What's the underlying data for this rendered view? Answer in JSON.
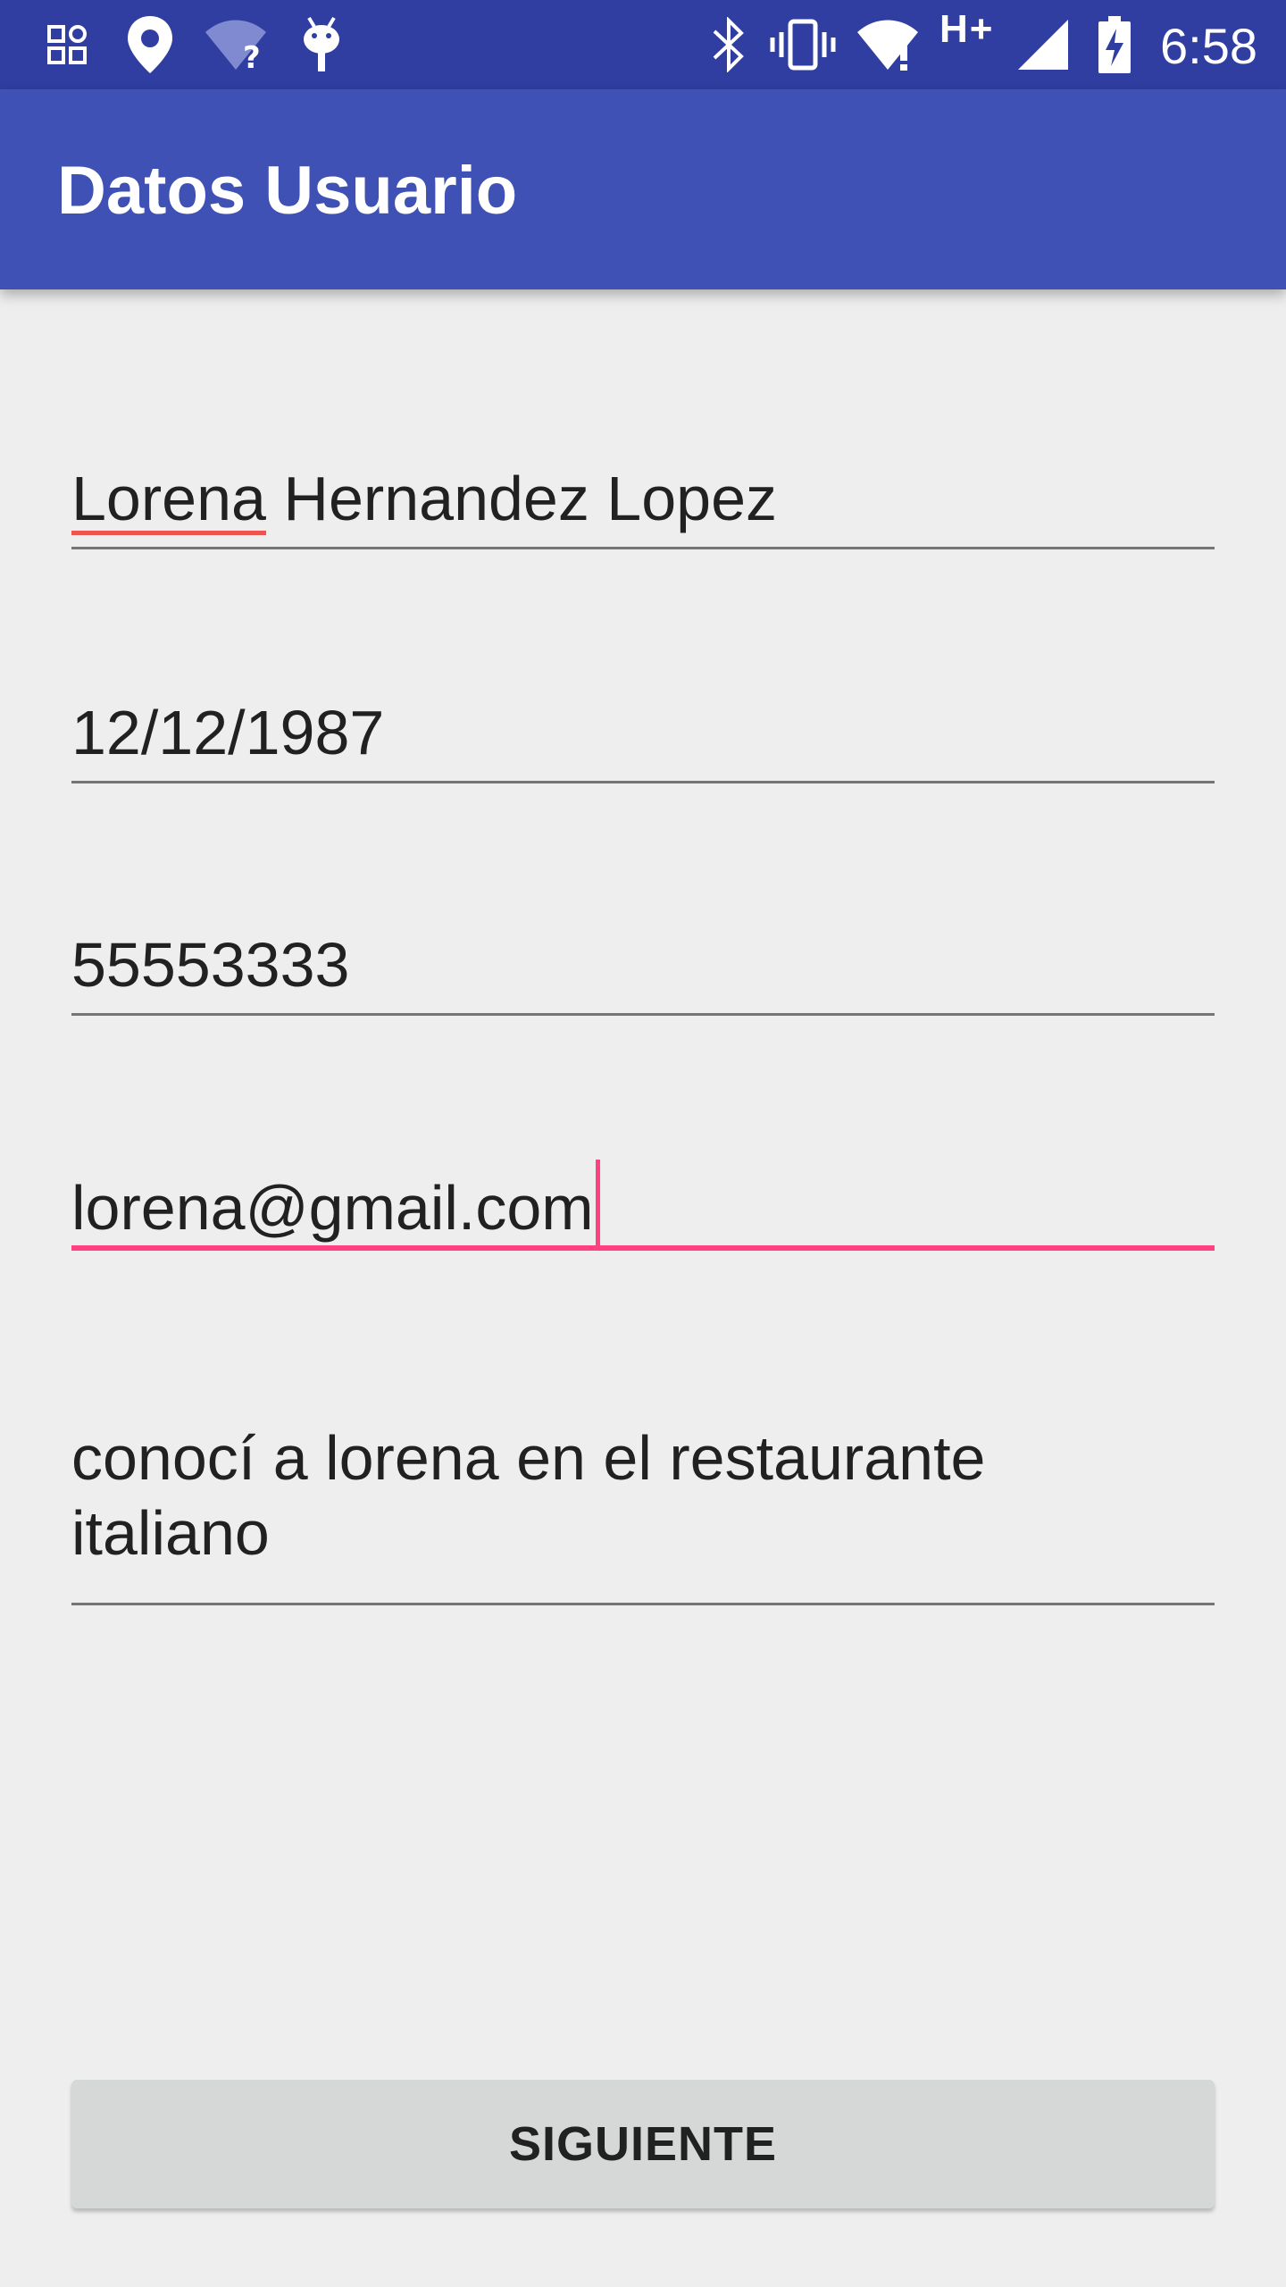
{
  "status_bar": {
    "time": "6:58",
    "network_type": "H+",
    "left_icons": [
      "apps-grid-icon",
      "location-pin-icon",
      "wifi-unknown-icon",
      "android-debug-icon"
    ],
    "right_icons": [
      "bluetooth-icon",
      "vibrate-icon",
      "wifi-alert-icon",
      "cell-signal-icon",
      "battery-charging-icon"
    ],
    "background_color": "#2f3ea0"
  },
  "app_bar": {
    "title": "Datos Usuario",
    "background_color": "#3f51b5"
  },
  "form": {
    "fields": [
      {
        "name": "nombre",
        "value": "Lorena Hernandez Lopez",
        "misspelled_word": "Lorena"
      },
      {
        "name": "fecha",
        "value": "12/12/1987"
      },
      {
        "name": "telefono",
        "value": "55553333"
      },
      {
        "name": "email",
        "value": "lorena@gmail.com",
        "focused": true
      },
      {
        "name": "descripcion",
        "value": "conocí a lorena en el restaurante\nitaliano"
      }
    ],
    "accent_color": "#ff4081"
  },
  "button": {
    "label": "SIGUIENTE"
  }
}
